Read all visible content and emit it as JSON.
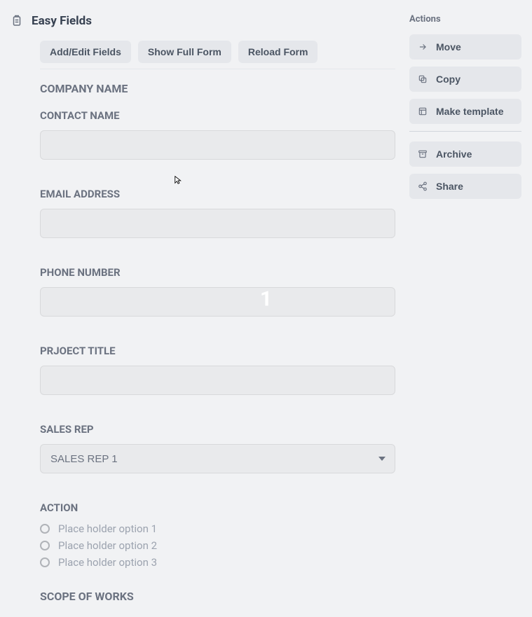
{
  "header": {
    "title": "Easy Fields"
  },
  "toolbar": {
    "add_edit": "Add/Edit Fields",
    "show_full": "Show Full Form",
    "reload": "Reload Form"
  },
  "company_header": "COMPANY NAME",
  "form": {
    "contact_name": {
      "label": "CONTACT NAME",
      "value": ""
    },
    "email": {
      "label": "EMAIL ADDRESS",
      "value": ""
    },
    "phone": {
      "label": "PHONE NUMBER",
      "value": ""
    },
    "project_title": {
      "label": "PRJOECT TITLE",
      "value": ""
    },
    "sales_rep": {
      "label": "SALES REP",
      "selected": "SALES REP 1"
    },
    "action": {
      "label": "ACTION",
      "options": [
        "Place holder option 1",
        "Place holder option 2",
        "Place holder option 3"
      ]
    },
    "scope_header": "SCOPE OF WORKS"
  },
  "actions": {
    "title": "Actions",
    "move": "Move",
    "copy": "Copy",
    "make_template": "Make template",
    "archive": "Archive",
    "share": "Share"
  },
  "overlay_number": "1"
}
